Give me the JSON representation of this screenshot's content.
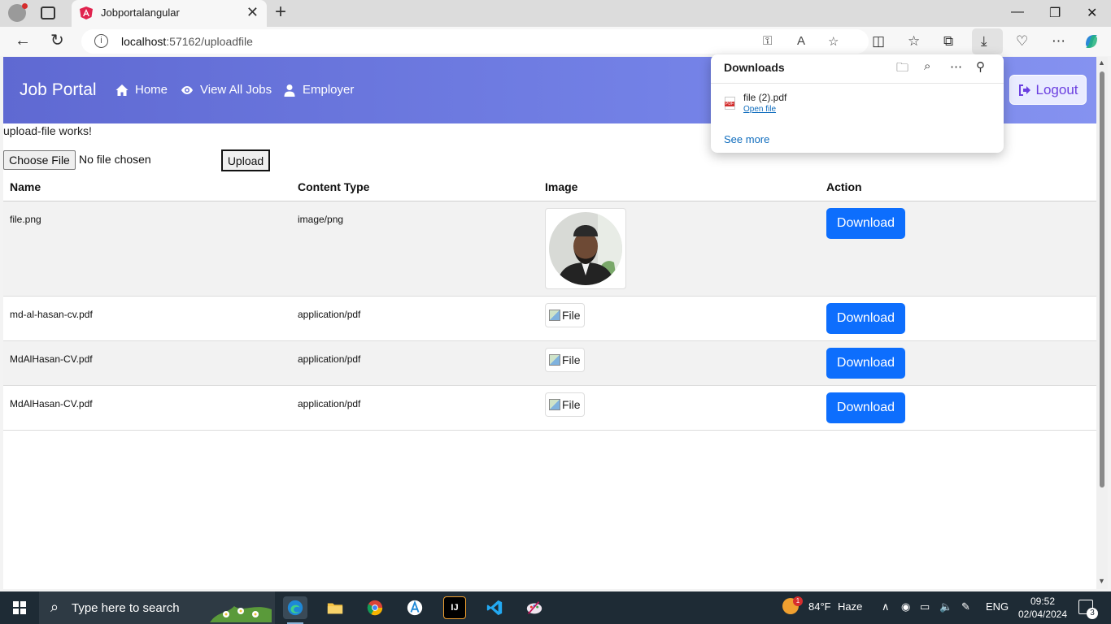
{
  "browser": {
    "tab_title": "Jobportalangular",
    "url_host": "localhost",
    "url_rest": ":57162/uploadfile"
  },
  "navbar": {
    "brand": "Job Portal",
    "links": [
      "Home",
      "View All Jobs",
      "Employer"
    ],
    "logout": "Logout"
  },
  "page": {
    "works_text": "upload-file works!",
    "choose_file": "Choose File",
    "no_file": "No file chosen",
    "upload": "Upload"
  },
  "table": {
    "headers": [
      "Name",
      "Content Type",
      "Image",
      "Action"
    ],
    "rows": [
      {
        "name": "file.png",
        "type": "image/png",
        "image": "photo",
        "action": "Download"
      },
      {
        "name": "md-al-hasan-cv.pdf",
        "type": "application/pdf",
        "image": "File",
        "action": "Download"
      },
      {
        "name": "MdAlHasan-CV.pdf",
        "type": "application/pdf",
        "image": "File",
        "action": "Download"
      },
      {
        "name": "MdAlHasan-CV.pdf",
        "type": "application/pdf",
        "image": "File",
        "action": "Download"
      }
    ]
  },
  "downloads": {
    "title": "Downloads",
    "file_name": "file (2).pdf",
    "open_file": "Open file",
    "see_more": "See more"
  },
  "taskbar": {
    "search_placeholder": "Type here to search",
    "weather_temp": "84°F",
    "weather_desc": "Haze",
    "weather_badge": "1",
    "language": "ENG",
    "time": "09:52",
    "date": "02/04/2024",
    "notifications": "3"
  },
  "colors": {
    "navbar_start": "#5f69d2",
    "navbar_end": "#8592f0",
    "download_button": "#0d6efd",
    "logout_text": "#6b3fe0",
    "link_blue": "#0f6cbd"
  }
}
